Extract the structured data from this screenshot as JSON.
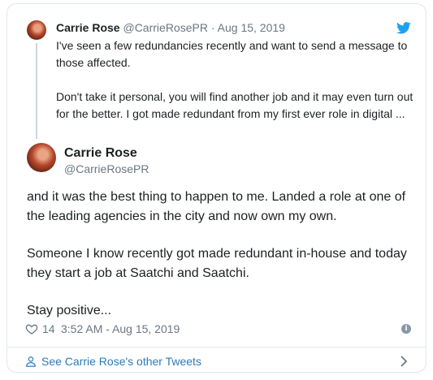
{
  "parent_tweet": {
    "name": "Carrie Rose",
    "handle": "@CarrieRosePR",
    "separator": "·",
    "date": "Aug 15, 2019",
    "paragraphs": [
      "I've seen a few redundancies recently and want to send a message to those affected.",
      "Don't take it personal, you will find another job and it may even turn out for the better. I got made redundant from my first ever role in digital ..."
    ]
  },
  "main_tweet": {
    "name": "Carrie Rose",
    "handle": "@CarrieRosePR",
    "paragraphs": [
      "and it was the best thing to happen to me. Landed a role at one of the leading agencies in the city and now own my own.",
      "Someone I know recently got made redundant in-house and today they start a job at Saatchi and Saatchi.",
      "Stay positive..."
    ],
    "likes": "14",
    "timestamp": "3:52 AM - Aug 15, 2019"
  },
  "footer": {
    "link_text": "See Carrie Rose's other Tweets"
  },
  "icons": {
    "brand": "twitter-bird-icon",
    "like": "heart-icon",
    "info": "info-icon",
    "profile": "person-icon",
    "next": "chevron-right-icon"
  },
  "colors": {
    "link": "#2b7bb9",
    "twitter_blue": "#1da1f2",
    "muted_text": "#697882",
    "border": "#e1e8ed"
  }
}
